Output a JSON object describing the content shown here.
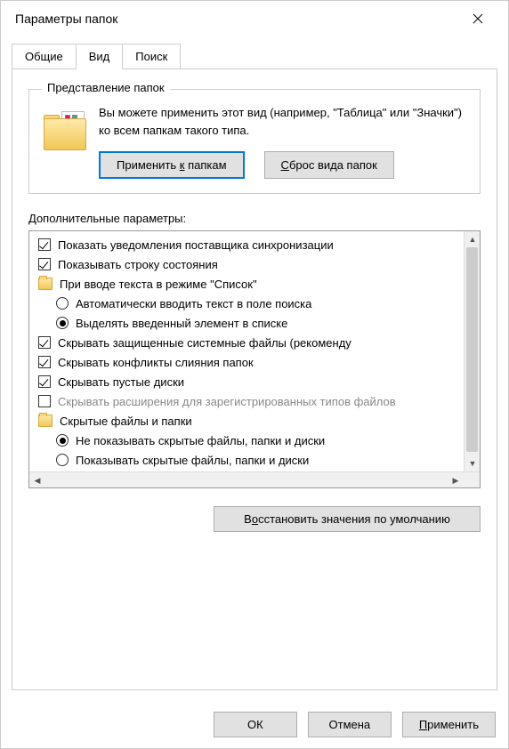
{
  "window": {
    "title": "Параметры папок"
  },
  "tabs": {
    "general": "Общие",
    "view": "Вид",
    "search": "Поиск"
  },
  "folder_views": {
    "group_title": "Представление папок",
    "description": "Вы можете применить этот вид (например, \"Таблица\" или \"Значки\") ко всем папкам такого типа.",
    "apply_btn": "Применить к папкам",
    "apply_underline": "к",
    "reset_btn": "Сброс вида папок",
    "reset_underline": "С"
  },
  "advanced": {
    "label": "Дополнительные параметры:",
    "items": [
      {
        "type": "check",
        "checked": true,
        "level": 0,
        "label": "Показать уведомления поставщика синхронизации"
      },
      {
        "type": "check",
        "checked": true,
        "level": 0,
        "label": "Показывать строку состояния"
      },
      {
        "type": "folder",
        "checked": false,
        "level": 0,
        "label": "При вводе текста в режиме \"Список\""
      },
      {
        "type": "radio",
        "checked": false,
        "level": 1,
        "label": "Автоматически вводить текст в поле поиска"
      },
      {
        "type": "radio",
        "checked": true,
        "level": 1,
        "label": "Выделять введенный элемент в списке"
      },
      {
        "type": "check",
        "checked": true,
        "level": 0,
        "label": "Скрывать защищенные системные файлы (рекоменду"
      },
      {
        "type": "check",
        "checked": true,
        "level": 0,
        "label": "Скрывать конфликты слияния папок"
      },
      {
        "type": "check",
        "checked": true,
        "level": 0,
        "label": "Скрывать пустые диски"
      },
      {
        "type": "check",
        "checked": false,
        "level": 0,
        "label": "Скрывать расширения для зарегистрированных типов файлов",
        "highlight": true
      },
      {
        "type": "folder",
        "checked": false,
        "level": 0,
        "label": "Скрытые файлы и папки"
      },
      {
        "type": "radio",
        "checked": true,
        "level": 1,
        "label": "Не показывать скрытые файлы, папки и диски"
      },
      {
        "type": "radio",
        "checked": false,
        "level": 1,
        "label": "Показывать скрытые файлы, папки и диски"
      }
    ]
  },
  "restore_defaults": "Восстановить значения по умолчанию",
  "restore_underline": "о",
  "buttons": {
    "ok": "ОК",
    "cancel": "Отмена",
    "apply": "Применить",
    "apply_underline": "П"
  }
}
